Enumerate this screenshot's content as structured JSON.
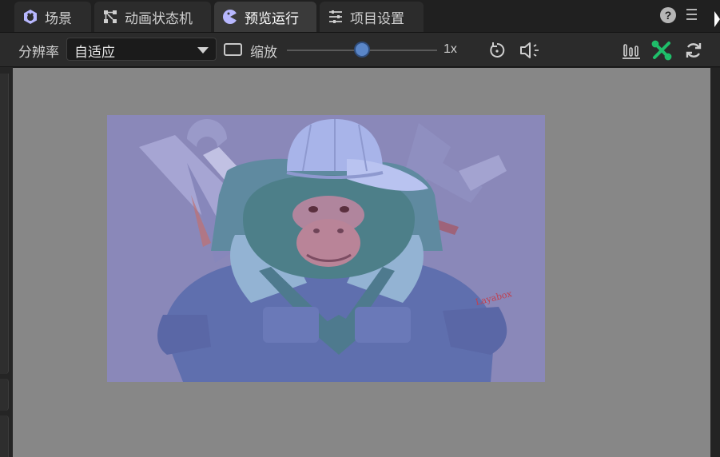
{
  "tabs": [
    {
      "label": "场景",
      "icon": "scene-icon",
      "active": false
    },
    {
      "label": "动画状态机",
      "icon": "state-machine-icon",
      "active": false
    },
    {
      "label": "预览运行",
      "icon": "preview-run-icon",
      "active": true
    },
    {
      "label": "项目设置",
      "icon": "project-settings-icon",
      "active": false
    }
  ],
  "header": {
    "help_icon": "help-icon",
    "help_glyph": "?",
    "menu_icon": "menu-icon"
  },
  "toolbar": {
    "resolution_label": "分辨率",
    "resolution_value": "自适应",
    "zoom_label": "缩放",
    "zoom_value_text": "1x",
    "zoom_level": 0.5,
    "icons": [
      "reset-icon",
      "mute-icon",
      "stats-icon",
      "debug-tools-icon",
      "refresh-icon"
    ]
  },
  "preview": {
    "shirt_text": "Layabox",
    "colors": {
      "viewport_bg": "#878787",
      "game_bg": "#8a88b9",
      "accent": "#5a86c8",
      "debug_green": "#1fbf6a"
    }
  }
}
